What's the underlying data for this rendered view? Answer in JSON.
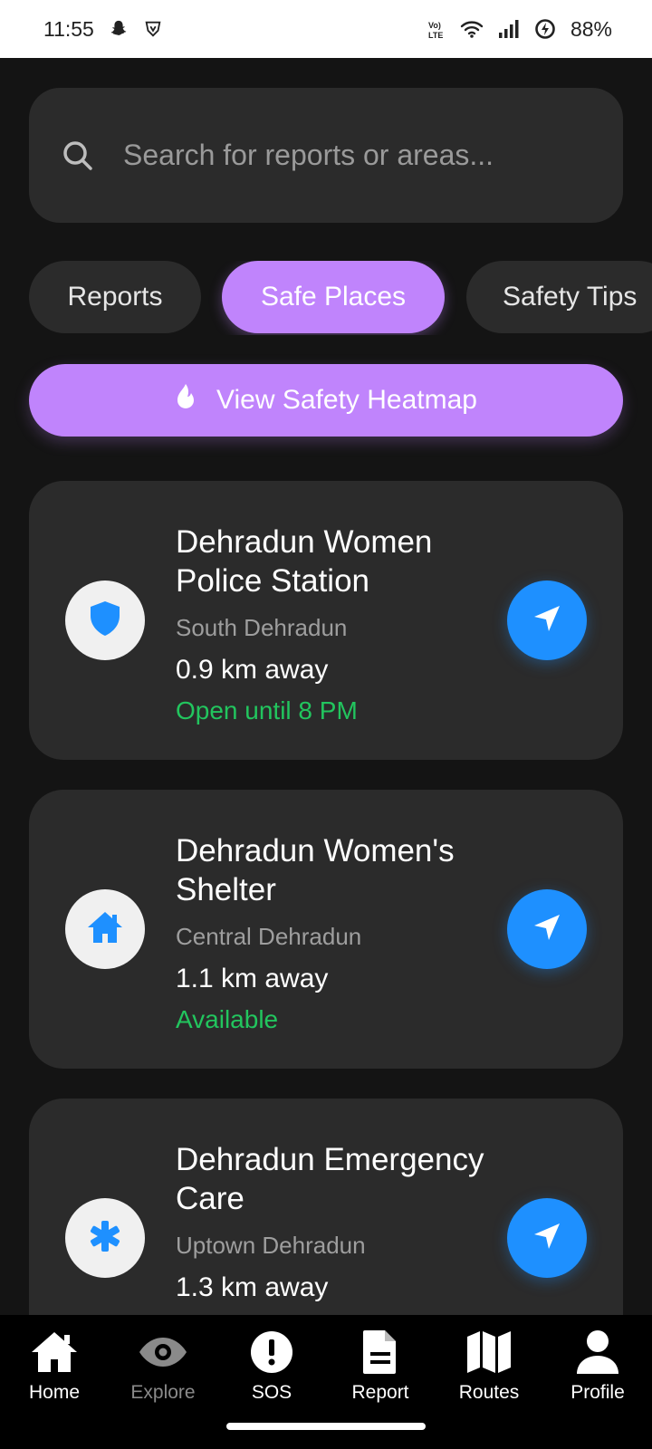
{
  "status_bar": {
    "time": "11:55",
    "battery": "88%",
    "icons": [
      "snapchat-icon",
      "vpn-shield-icon",
      "volte-icon",
      "wifi-icon",
      "signal-icon",
      "battery-saver-icon"
    ]
  },
  "search": {
    "placeholder": "Search for reports or areas...",
    "icon": "search-icon"
  },
  "tabs": [
    {
      "label": "Reports",
      "active": false
    },
    {
      "label": "Safe Places",
      "active": true
    },
    {
      "label": "Safety Tips",
      "active": false
    }
  ],
  "heatmap_button": {
    "label": "View Safety Heatmap",
    "icon": "flame-icon"
  },
  "places": [
    {
      "name": "Dehradun Women Police Station",
      "area": "South Dehradun",
      "distance": "0.9 km away",
      "status": "Open until 8 PM",
      "icon": "shield-icon"
    },
    {
      "name": "Dehradun Women's Shelter",
      "area": "Central Dehradun",
      "distance": "1.1 km away",
      "status": "Available",
      "icon": "house-icon"
    },
    {
      "name": "Dehradun Emergency Care",
      "area": "Uptown Dehradun",
      "distance": "1.3 km away",
      "status": "",
      "icon": "medical-asterisk-icon"
    }
  ],
  "colors": {
    "accent": "#c084fc",
    "nav_blue": "#1e90ff",
    "status_green": "#22c55e",
    "card_bg": "#2b2b2b",
    "page_bg": "#141414"
  },
  "bottom_nav": [
    {
      "label": "Home",
      "icon": "home-icon"
    },
    {
      "label": "Explore",
      "icon": "eye-icon"
    },
    {
      "label": "SOS",
      "icon": "alert-icon"
    },
    {
      "label": "Report",
      "icon": "document-icon"
    },
    {
      "label": "Routes",
      "icon": "map-icon"
    },
    {
      "label": "Profile",
      "icon": "user-icon"
    }
  ]
}
